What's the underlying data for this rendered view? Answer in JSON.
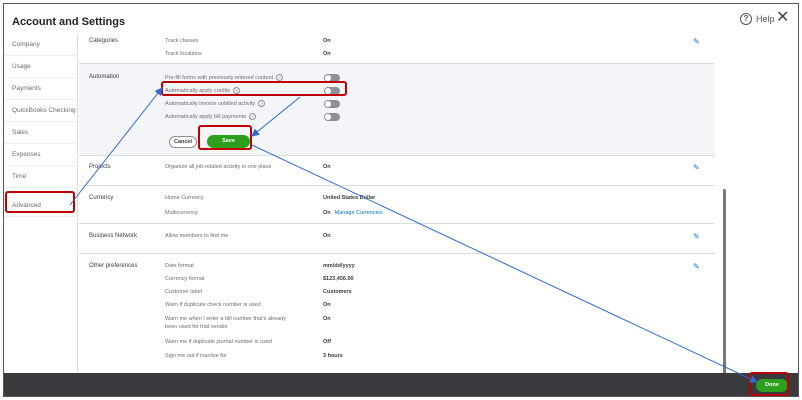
{
  "header": {
    "title": "Account and Settings",
    "help_label": "Help",
    "close_glyph": "✕"
  },
  "sidebar": {
    "items": [
      {
        "label": "Company"
      },
      {
        "label": "Usage"
      },
      {
        "label": "Payments"
      },
      {
        "label": "QuickBooks Checking"
      },
      {
        "label": "Sales"
      },
      {
        "label": "Expenses"
      },
      {
        "label": "Time"
      },
      {
        "label": "Advanced",
        "selected": true
      }
    ]
  },
  "sections": {
    "categories": {
      "label": "Categories",
      "rows": [
        {
          "label": "Track classes",
          "value": "On"
        },
        {
          "label": "Track locations",
          "value": "On"
        }
      ]
    },
    "automation": {
      "label": "Automation",
      "rows": [
        {
          "label": "Pre-fill forms with previously entered content",
          "toggle": "off"
        },
        {
          "label": "Automatically apply credits",
          "toggle": "off"
        },
        {
          "label": "Automatically invoice unbilled activity",
          "toggle": "off"
        },
        {
          "label": "Automatically apply bill payments",
          "toggle": "off"
        }
      ],
      "cancel_label": "Cancel",
      "save_label": "Save"
    },
    "projects": {
      "label": "Projects",
      "rows": [
        {
          "label": "Organize all job-related activity in one place",
          "value": "On"
        }
      ]
    },
    "currency": {
      "label": "Currency",
      "rows": [
        {
          "label": "Home Currency",
          "value": "United States Dollar"
        },
        {
          "label": "Multicurrency",
          "value": "On",
          "link": "Manage Currencies"
        }
      ]
    },
    "business_network": {
      "label": "Business Network",
      "rows": [
        {
          "label": "Allow members to find me",
          "value": "On"
        }
      ]
    },
    "other_preferences": {
      "label": "Other preferences",
      "rows": [
        {
          "label": "Date format",
          "value": "mm/dd/yyyy"
        },
        {
          "label": "Currency format",
          "value": "$123,456.00"
        },
        {
          "label": "Customer label",
          "value": "Customers"
        },
        {
          "label": "Warn if duplicate check number is used",
          "value": "On"
        },
        {
          "label": "Warn me when I enter a bill number that's already",
          "label2": "been used for that vendor",
          "value": "On"
        },
        {
          "label": "Warn me if duplicate journal number is used",
          "value": "Off"
        },
        {
          "label": "Sign me out if inactive for",
          "value": "3 hours"
        }
      ]
    }
  },
  "footer": {
    "done_label": "Done"
  },
  "colors": {
    "accent_green": "#2ca01c",
    "link_blue": "#0077c5",
    "highlight_red": "#c00000",
    "footer_bg": "#393a3d"
  }
}
